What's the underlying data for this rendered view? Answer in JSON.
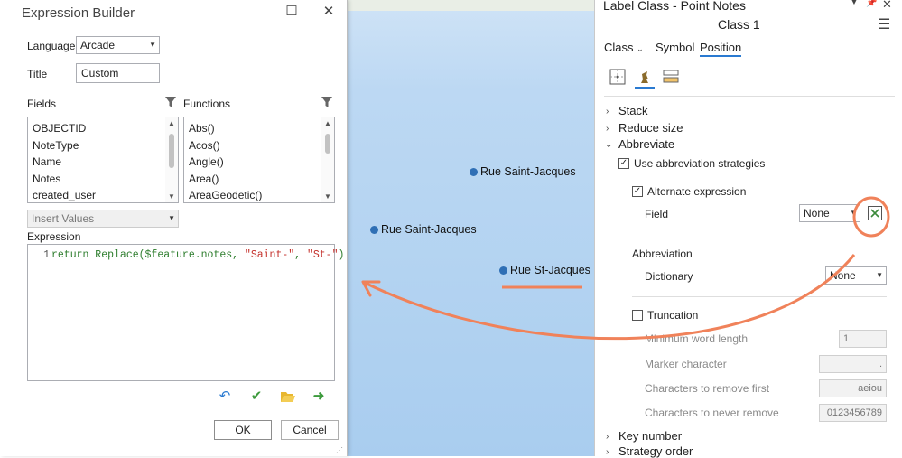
{
  "expression_builder": {
    "title": "Expression Builder",
    "language_label": "Language",
    "language_value": "Arcade",
    "title_label": "Title",
    "title_value": "Custom",
    "fields_label": "Fields",
    "functions_label": "Functions",
    "fields": [
      "OBJECTID",
      "NoteType",
      "Name",
      "Notes",
      "created_user"
    ],
    "functions": [
      "Abs()",
      "Acos()",
      "Angle()",
      "Area()",
      "AreaGeodetic()"
    ],
    "insert_values_placeholder": "Insert Values",
    "expression_label": "Expression",
    "code_line_number": "1",
    "code_prefix": "return Replace($feature.notes, ",
    "code_arg1": "\"Saint-\"",
    "code_sep": ", ",
    "code_arg2": "\"St-\"",
    "code_suffix": ")",
    "ok_label": "OK",
    "cancel_label": "Cancel"
  },
  "map": {
    "points": [
      "Rue Saint-Jacques",
      "Rue Saint-Jacques",
      "Rue St-Jacques"
    ]
  },
  "label_class": {
    "title": "Label Class - Point Notes",
    "class_name": "Class 1",
    "tabs": [
      "Class",
      "Symbol",
      "Position"
    ],
    "active_tab": "Position",
    "sections": {
      "stack": "Stack",
      "reduce_size": "Reduce size",
      "abbreviate": "Abbreviate",
      "key_number": "Key number",
      "strategy_order": "Strategy order"
    },
    "use_abbrev_label": "Use abbreviation strategies",
    "alt_expr_label": "Alternate expression",
    "field_label": "Field",
    "field_value": "None",
    "abbreviation_label": "Abbreviation",
    "dictionary_label": "Dictionary",
    "dictionary_value": "None",
    "truncation_label": "Truncation",
    "min_word_length_label": "Minimum word length",
    "min_word_length_value": "1",
    "marker_char_label": "Marker character",
    "marker_char_value": ".",
    "chars_remove_first_label": "Characters to remove first",
    "chars_remove_first_value": "aeiou",
    "chars_never_remove_label": "Characters to never remove",
    "chars_never_remove_value": "0123456789"
  },
  "colors": {
    "annotation": "#f0825a",
    "point": "#2f6fb5",
    "water": "#b3d3f1"
  }
}
